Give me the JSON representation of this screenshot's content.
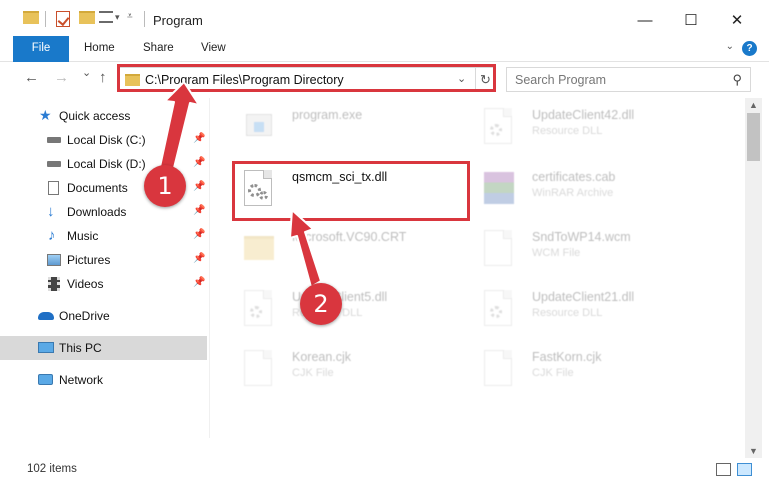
{
  "window": {
    "title": "Program",
    "minimize_glyph": "—",
    "maximize_glyph": "☐",
    "close_glyph": "✕"
  },
  "ribbon": {
    "tabs": [
      "File",
      "Home",
      "Share",
      "View"
    ],
    "help_glyph": "?"
  },
  "nav": {
    "back_glyph": "←",
    "forward_glyph": "→",
    "recent_glyph": "⌄",
    "up_glyph": "↑",
    "address": "C:\\Program Files\\Program Directory",
    "dropdown_glyph": "⌄",
    "refresh_glyph": "↻",
    "search_placeholder": "Search Program",
    "search_glyph": "⚲"
  },
  "sidebar": {
    "items": [
      {
        "label": "Quick access",
        "icon": "star-icon",
        "pinned": false
      },
      {
        "label": "Local Disk (C:)",
        "icon": "drive-icon",
        "pinned": true
      },
      {
        "label": "Local Disk (D:)",
        "icon": "drive-icon",
        "pinned": true
      },
      {
        "label": "Documents",
        "icon": "documents-icon",
        "pinned": true
      },
      {
        "label": "Downloads",
        "icon": "download-icon",
        "pinned": true
      },
      {
        "label": "Music",
        "icon": "music-icon",
        "pinned": true
      },
      {
        "label": "Pictures",
        "icon": "pictures-icon",
        "pinned": true
      },
      {
        "label": "Videos",
        "icon": "videos-icon",
        "pinned": true
      },
      {
        "label": "OneDrive",
        "icon": "cloud-icon",
        "pinned": false
      },
      {
        "label": "This PC",
        "icon": "computer-icon",
        "pinned": false
      },
      {
        "label": "Network",
        "icon": "network-icon",
        "pinned": false
      }
    ],
    "pin_glyph": "📌"
  },
  "files": [
    {
      "name": "program.exe",
      "type": ""
    },
    {
      "name": "UpdateClient42.dll",
      "type": "Resource DLL"
    },
    {
      "name": "qsmcm_sci_tx.dll",
      "type": ""
    },
    {
      "name": "certificates.cab",
      "type": "WinRAR Archive"
    },
    {
      "name": "Microsoft.VC90.CRT",
      "type": ""
    },
    {
      "name": "SndToWP14.wcm",
      "type": "WCM File"
    },
    {
      "name": "UpdateClient5.dll",
      "type": "Resource DLL"
    },
    {
      "name": "UpdateClient21.dll",
      "type": "Resource DLL"
    },
    {
      "name": "Korean.cjk",
      "type": "CJK File"
    },
    {
      "name": "FastKorn.cjk",
      "type": "CJK File"
    }
  ],
  "status": {
    "item_count": "102 items"
  },
  "annotations": {
    "step1": "1",
    "step2": "2",
    "highlight_color": "#d9363e"
  }
}
